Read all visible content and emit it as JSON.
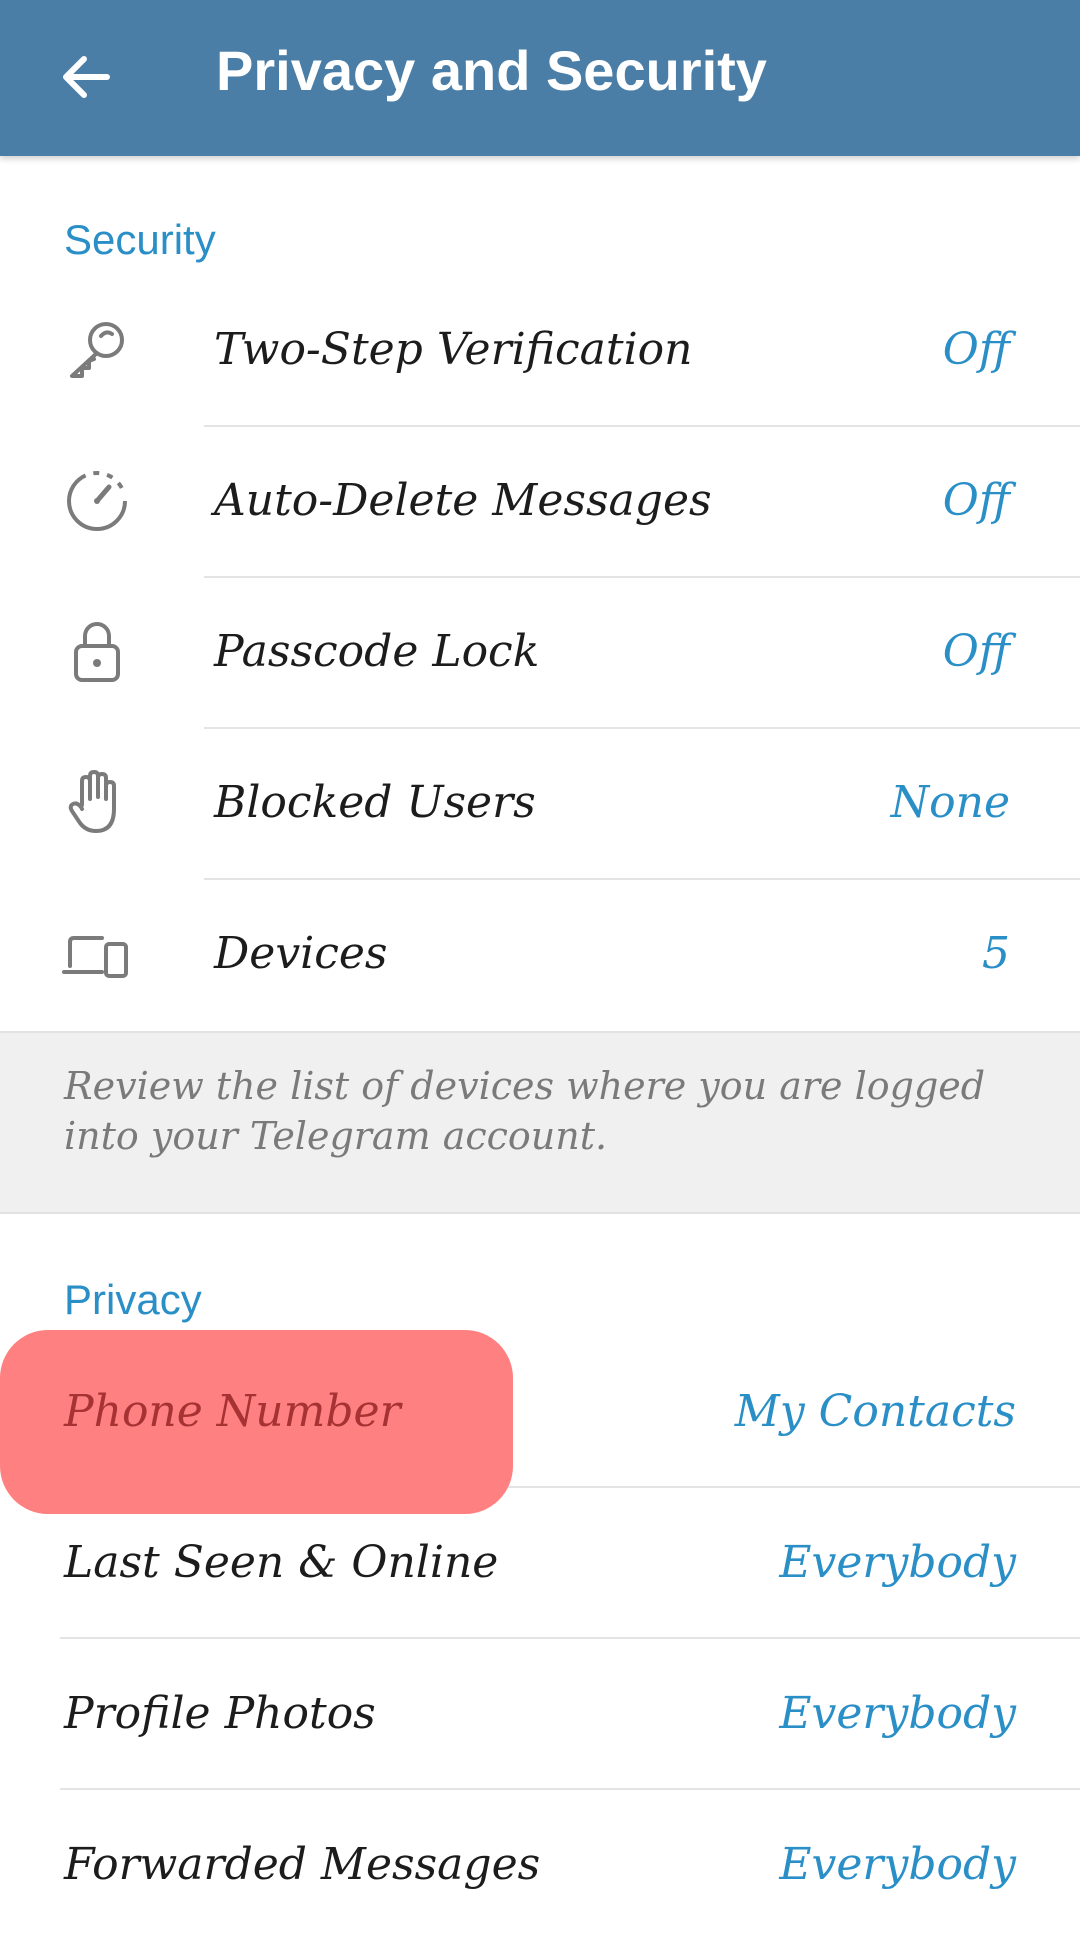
{
  "app_bar": {
    "title": "Privacy and Security",
    "back_icon": "arrow-left-icon"
  },
  "security": {
    "header": "Security",
    "items": [
      {
        "label": "Two-Step Verification",
        "value": "Off",
        "icon": "key-icon"
      },
      {
        "label": "Auto-Delete Messages",
        "value": "Off",
        "icon": "timer-icon"
      },
      {
        "label": "Passcode Lock",
        "value": "Off",
        "icon": "lock-icon"
      },
      {
        "label": "Blocked Users",
        "value": "None",
        "icon": "hand-icon"
      },
      {
        "label": "Devices",
        "value": "5",
        "icon": "devices-icon"
      }
    ],
    "info": "Review the list of devices where you are logged into your Telegram account."
  },
  "privacy": {
    "header": "Privacy",
    "items": [
      {
        "label": "Phone Number",
        "value": "My Contacts",
        "highlighted": true
      },
      {
        "label": "Last Seen & Online",
        "value": "Everybody"
      },
      {
        "label": "Profile Photos",
        "value": "Everybody"
      },
      {
        "label": "Forwarded Messages",
        "value": "Everybody"
      }
    ]
  },
  "colors": {
    "app_bar": "#4a7ea6",
    "accent": "#2b8fc7",
    "highlight": "#ff8080",
    "highlight_text": "#a63234"
  }
}
